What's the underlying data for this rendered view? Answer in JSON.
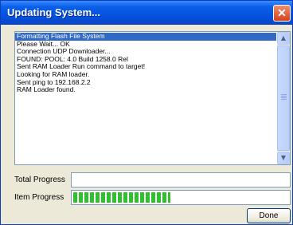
{
  "window": {
    "title": "Updating System...",
    "close_glyph": "✕"
  },
  "log": {
    "lines": [
      "Formatting Flash File System",
      "Please Wait... OK",
      "Connection UDP Downloader...",
      "FOUND: POOL: 4.0 Build 1258.0 Rel",
      "Sent RAM Loader Run command to target!",
      "Looking for RAM loader.",
      "Sent ping to 192.168.2.2",
      "RAM Loader found."
    ],
    "selected_index": 0
  },
  "progress": {
    "total_label": "Total Progress",
    "total_value": 0,
    "item_label": "Item Progress",
    "item_value": 0.45
  },
  "buttons": {
    "done_label": "Done"
  },
  "icons": {
    "scroll_up": "scroll-up-arrow-icon",
    "scroll_down": "scroll-down-arrow-icon",
    "close": "close-icon"
  },
  "colors": {
    "title_bar": "#0550dc",
    "selection": "#316ac5",
    "progress_fill": "#2fbf2f"
  }
}
